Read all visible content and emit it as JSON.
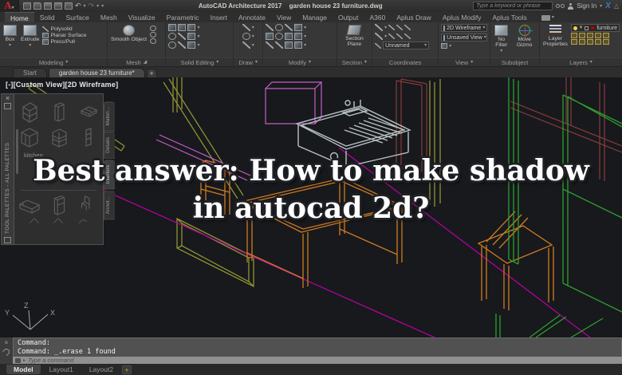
{
  "window": {
    "app_title": "AutoCAD Architecture 2017",
    "doc_title": "garden house 23 furniture.dwg",
    "search_placeholder": "Type a keyword or phrase",
    "signin_label": "Sign In"
  },
  "ribbon": {
    "tabs": [
      "Home",
      "Solid",
      "Surface",
      "Mesh",
      "Visualize",
      "Parametric",
      "Insert",
      "Annotate",
      "View",
      "Manage",
      "Output",
      "A360",
      "Aplus Draw",
      "Aplus Modify",
      "Aplus Tools"
    ],
    "active_tab": "Home",
    "panels": {
      "modeling": {
        "label": "Modeling",
        "box": "Box",
        "extrude": "Extrude",
        "polysolid": "Polysolid",
        "planar": "Planar Surface",
        "presspull": "Press/Pull"
      },
      "mesh": {
        "label": "Mesh",
        "smooth": "Smooth Object"
      },
      "solid_editing": {
        "label": "Solid Editing"
      },
      "draw": {
        "label": "Draw"
      },
      "modify": {
        "label": "Modify"
      },
      "section": {
        "label": "Section",
        "plane": "Section Plane"
      },
      "coordinates": {
        "label": "Coordinates",
        "dropdown": "Unnamed"
      },
      "view": {
        "label": "View",
        "visual_style": "2D Wireframe",
        "view_name": "Unsaved View"
      },
      "subobject": {
        "label": "Subobject",
        "no_filter": "No Filter",
        "move_gizmo": "Move Gizmo"
      },
      "layers": {
        "label": "Layers",
        "properties": "Layer Properties",
        "current_layer": "furniture",
        "layer_color": "#b40000"
      }
    }
  },
  "file_tabs": {
    "start": "Start",
    "drawing": "garden house 23 furniture*",
    "add": "+"
  },
  "viewport": {
    "label": "[-][Custom View][2D Wireframe]"
  },
  "palette": {
    "title": "TOOL PALETTES - ALL PALETTES",
    "group": "kitchen",
    "tabs": [
      "Materi...",
      "Details",
      "Interiors",
      "Annot..."
    ]
  },
  "overlay": {
    "line1": "Best answer: How to make shadow",
    "line2": "in autocad 2d?"
  },
  "command": {
    "line1": "Command:",
    "line2": "Command: _.erase 1 found",
    "placeholder": "Type a command"
  },
  "layout_tabs": {
    "model": "Model",
    "layout1": "Layout1",
    "layout2": "Layout2",
    "add": "+"
  },
  "ucs": {
    "x": "X",
    "y": "Y",
    "z": "Z"
  },
  "colors": {
    "canvas_bg": "#17191d",
    "wire_yellow": "#8f9331",
    "wire_magenta": "#b5009b",
    "wire_pink": "#c75fc7",
    "wire_orange": "#cf7a20",
    "wire_green": "#2f9e2f",
    "wire_gray": "#b9c2c2",
    "wire_maroon": "#8a3b3b",
    "layer_red": "#b40000"
  }
}
